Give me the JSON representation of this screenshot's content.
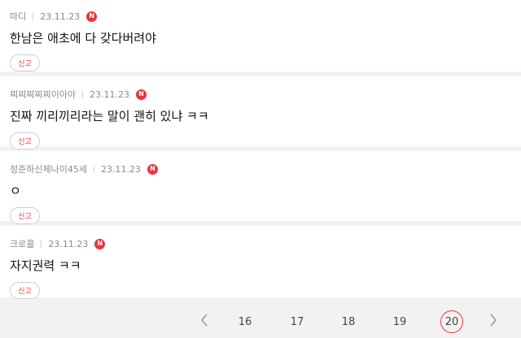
{
  "comments": [
    {
      "author": "마디",
      "date": "23.11.23",
      "badge": "N",
      "text": "한남은 애초에 다 갖다버려야",
      "report_label": "신고"
    },
    {
      "author": "찌찌찌찌찌이아야",
      "date": "23.11.23",
      "badge": "N",
      "text": "진짜 끼리끼리라는 말이 괜히 있냐 ㅋㅋ",
      "report_label": "신고"
    },
    {
      "author": "정준하신체나이45세",
      "date": "23.11.23",
      "badge": "N",
      "text": "ㅇ",
      "report_label": "신고"
    },
    {
      "author": "크로콜",
      "date": "23.11.23",
      "badge": "N",
      "text": "자지권력 ㅋㅋ",
      "report_label": "신고"
    }
  ],
  "pagination": {
    "pages": [
      "16",
      "17",
      "18",
      "19",
      "20"
    ],
    "current": "20",
    "accent": "#e8343d"
  }
}
